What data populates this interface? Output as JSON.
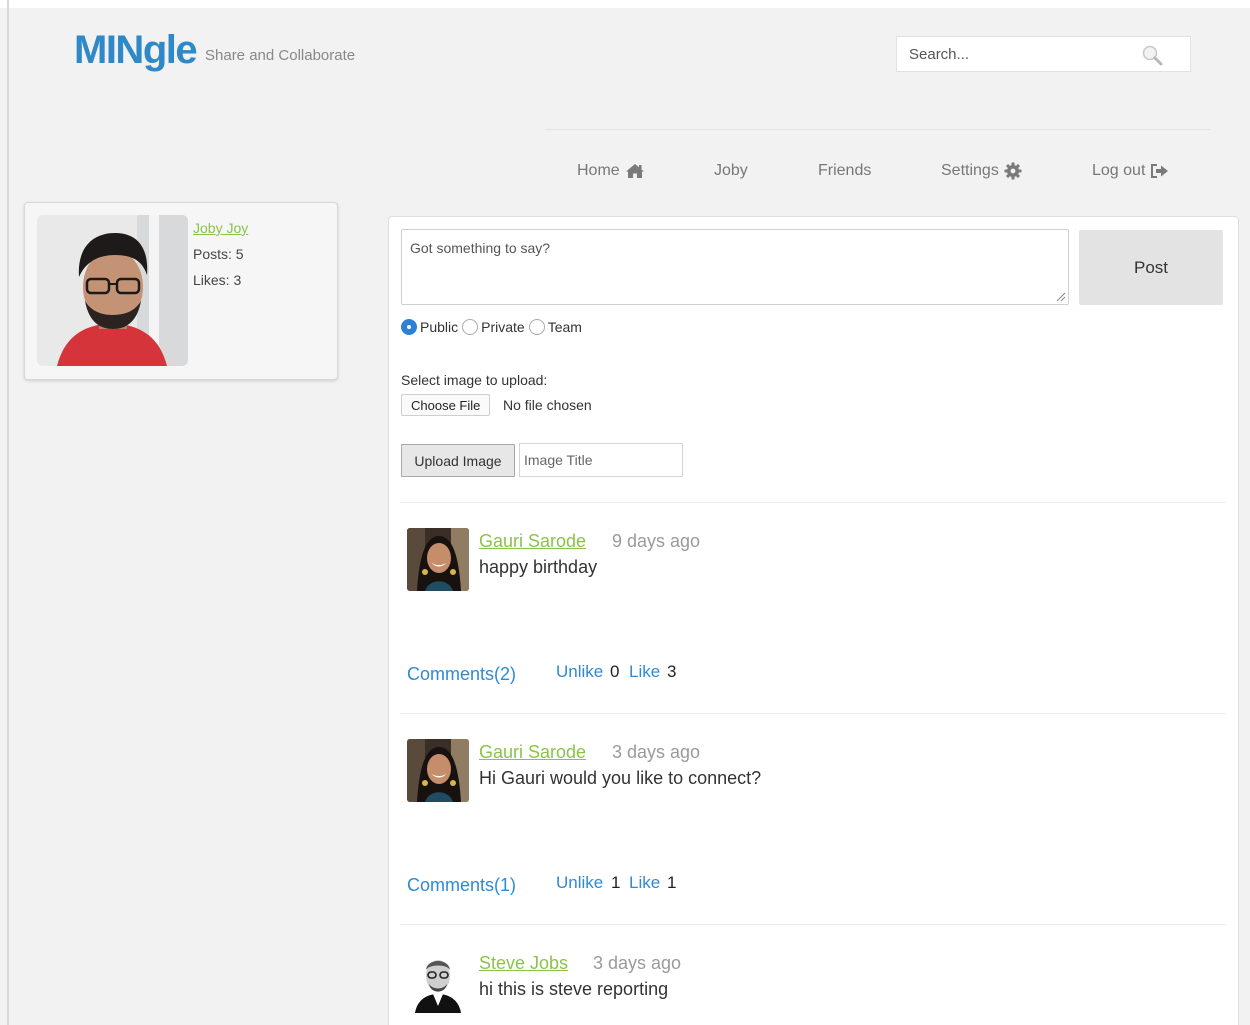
{
  "header": {
    "logo": "MINgle",
    "tagline": "Share and Collaborate",
    "search_placeholder": "Search..."
  },
  "nav": {
    "home": "Home",
    "joby": "Joby",
    "friends": "Friends",
    "settings": "Settings",
    "logout": "Log out"
  },
  "profile": {
    "name": "Joby Joy",
    "posts": "Posts: 5",
    "likes": "Likes: 3"
  },
  "composer": {
    "placeholder": "Got something to say?",
    "post_label": "Post",
    "visibility": [
      {
        "label": "Public",
        "checked": true
      },
      {
        "label": "Private",
        "checked": false
      },
      {
        "label": "Team",
        "checked": false
      }
    ],
    "upload_label": "Select image to upload:",
    "choose_file": "Choose File",
    "no_file": "No file chosen",
    "upload_button": "Upload Image",
    "image_title_placeholder": "Image Title"
  },
  "posts": [
    {
      "author": "Gauri Sarode",
      "time": "9 days ago",
      "text": "happy birthday",
      "comments": "Comments(2)",
      "unlike": "Unlike",
      "unlike_count": "0",
      "like": "Like",
      "like_count": "3"
    },
    {
      "author": "Gauri Sarode",
      "time": "3 days ago",
      "text": "Hi Gauri would you like to connect?",
      "comments": "Comments(1)",
      "unlike": "Unlike",
      "unlike_count": "1",
      "like": "Like",
      "like_count": "1"
    },
    {
      "author": "Steve Jobs",
      "time": "3 days ago",
      "text": "hi this is steve reporting"
    }
  ],
  "colors": {
    "brand": "#2f88c7",
    "author_link": "#8bc34a",
    "action_link": "#2f8ad6"
  }
}
